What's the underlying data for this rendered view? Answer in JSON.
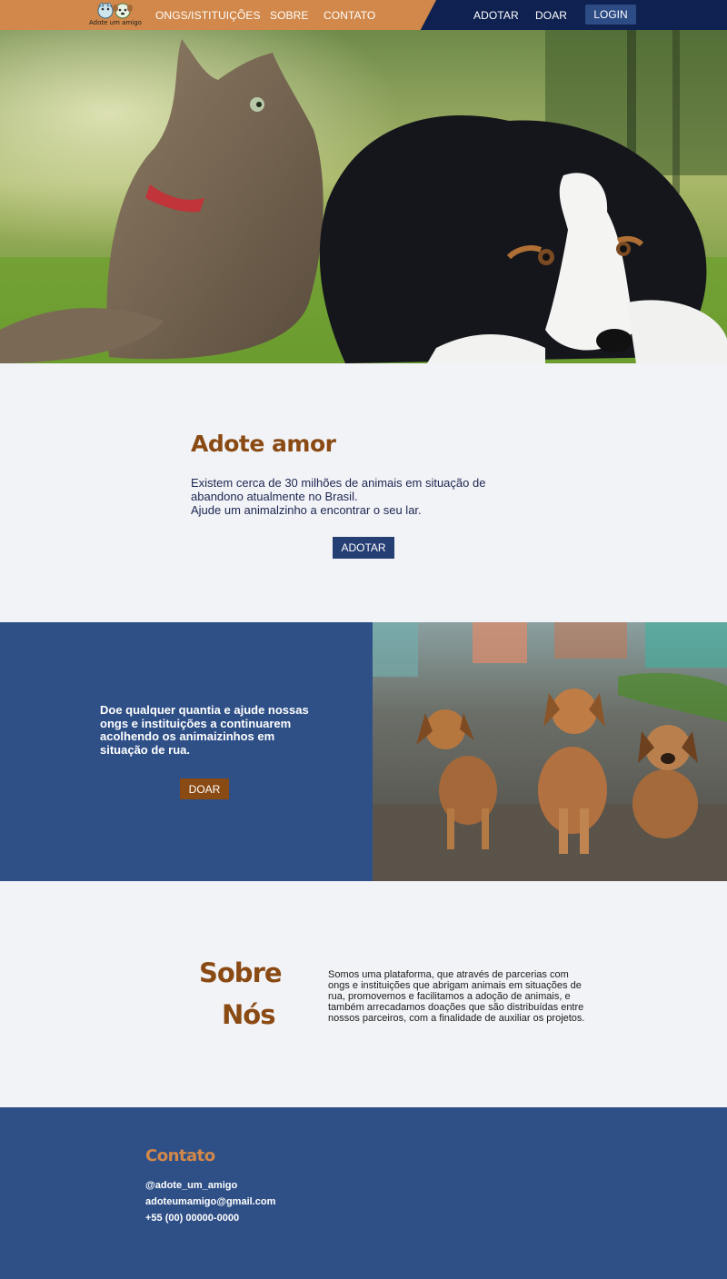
{
  "header": {
    "logo_text": "Adote um amigo",
    "nav_left": [
      "ONGS/ISTITUIÇÕES",
      "SOBRE",
      "CONTATO"
    ],
    "nav_right": [
      "ADOTAR",
      "DOAR"
    ],
    "login_label": "LOGIN",
    "colors": {
      "left_bg": "#d1884a",
      "right_bg": "#0f2150"
    }
  },
  "adopt": {
    "title": "Adote amor",
    "line1": "Existem cerca de 30 milhões de animais em situação de abandono atualmente no Brasil.",
    "line2": "Ajude um animalzinho a encontrar o seu lar.",
    "button": "ADOTAR"
  },
  "donate": {
    "text": "Doe qualquer quantia e ajude nossas ongs e instituições a continuarem acolhendo os animaizinhos em situação de rua.",
    "button": "DOAR",
    "panel_color": "#2f5087",
    "button_color": "#8a4a13"
  },
  "about": {
    "title_line1": "Sobre",
    "title_line2": "Nós",
    "text": "Somos uma plataforma, que através de parcerias com ongs e instituições que abrigam animais em situações de rua, promovemos e facilitamos a adoção de animais, e também arrecadamos doações que são distribuídas entre nossos parceiros, com a finalidade de auxiliar os projetos."
  },
  "footer": {
    "title": "Contato",
    "instagram": "@adote_um_amigo",
    "email": "adoteumamigo@gmail.com",
    "phone": "+55 (00) 00000-0000"
  }
}
